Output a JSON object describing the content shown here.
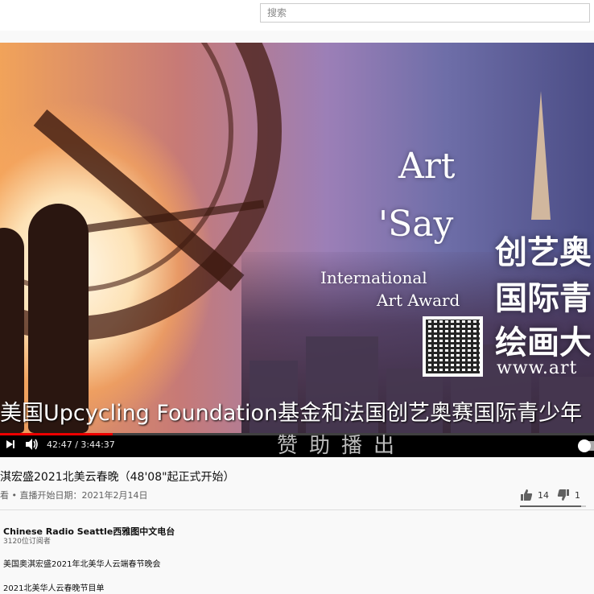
{
  "search": {
    "placeholder": "搜索"
  },
  "video": {
    "overlay_art": "Art",
    "overlay_say": "'Say",
    "overlay_international": "International",
    "overlay_award": "Art Award",
    "overlay_cn_line1": "创艺奥",
    "overlay_cn_line2": "国际青",
    "overlay_cn_line3": "绘画大",
    "overlay_url": "www.art",
    "subtitle_line1": "美国Upcycling Foundation基金和法国创艺奥赛国际青少年",
    "subtitle_line2": "赞助播出"
  },
  "player": {
    "time_display": "42:47 / 3:44:37",
    "progress": 0.19
  },
  "info": {
    "title": "淇宏盛2021北美云春晚（48'08\"起正式开始）",
    "meta": "看 • 直播开始日期：2021年2月14日",
    "likes": "14",
    "dislikes": "1",
    "like_ratio": 0.93
  },
  "channel": {
    "name": "Chinese Radio Seattle西雅图中文电台",
    "subscribers": "3120位订阅者"
  },
  "description": {
    "line1": "美国奥淇宏盛2021年北美华人云端春节晚会",
    "line2": "2021北美华人云春晚节目单"
  }
}
